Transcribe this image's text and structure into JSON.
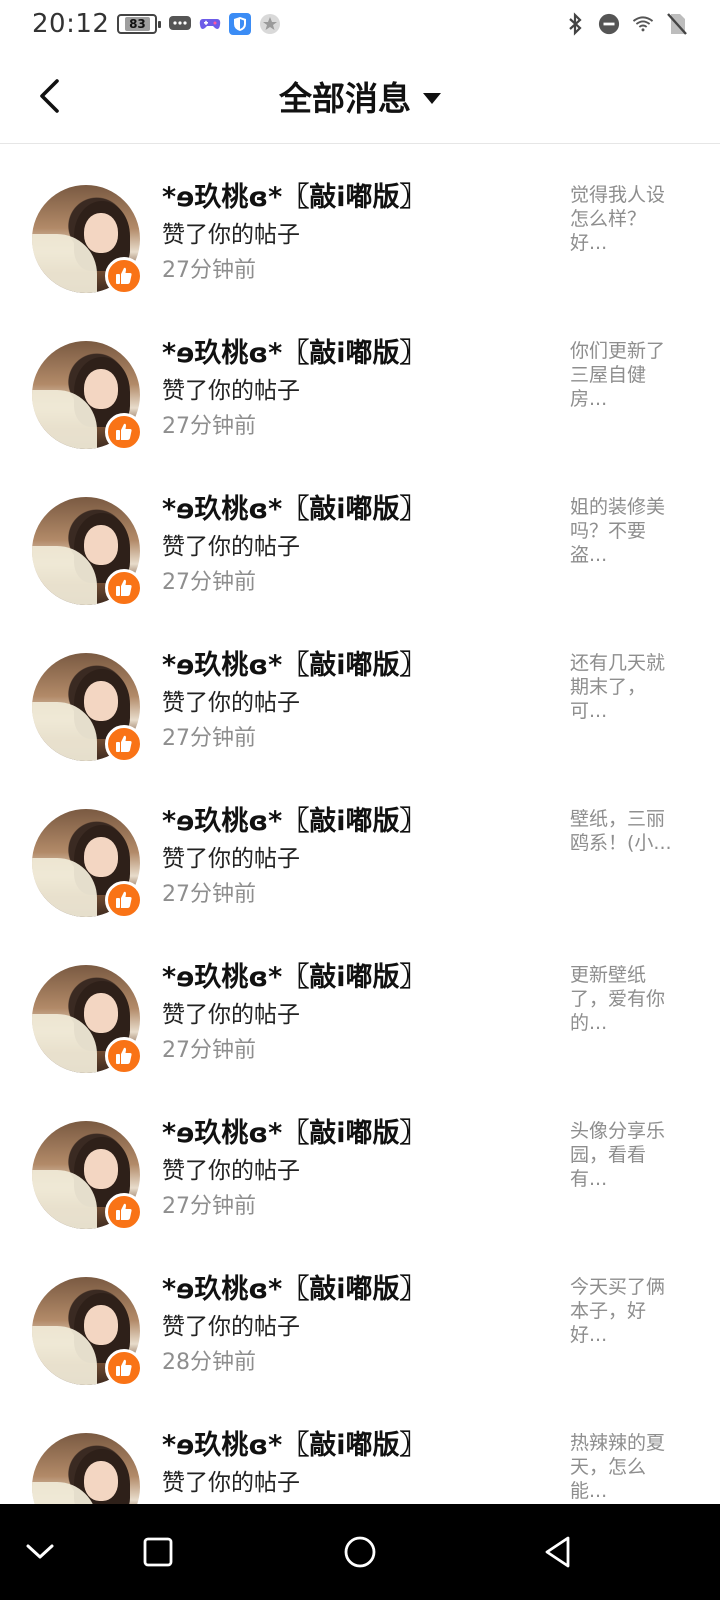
{
  "status_bar": {
    "time": "20:12",
    "battery": "83",
    "left_icons": [
      "chat-bubble-icon",
      "game-controller-icon",
      "shield-app-icon",
      "star-icon"
    ],
    "right_icons": [
      "bluetooth-icon",
      "do-not-disturb-icon",
      "wifi-icon",
      "no-sim-icon"
    ]
  },
  "header": {
    "title": "全部消息",
    "back_icon": "chevron-left-icon",
    "dropdown_icon": "caret-down-icon"
  },
  "notifications": [
    {
      "user": "*ɘ玖桃ɞ*〖敲i嘟版〗",
      "action": "赞了你的帖子",
      "time": "27分钟前",
      "preview": "觉得我人设怎么样？好..."
    },
    {
      "user": "*ɘ玖桃ɞ*〖敲i嘟版〗",
      "action": "赞了你的帖子",
      "time": "27分钟前",
      "preview": "你们更新了三屋自健房..."
    },
    {
      "user": "*ɘ玖桃ɞ*〖敲i嘟版〗",
      "action": "赞了你的帖子",
      "time": "27分钟前",
      "preview": "姐的装修美吗？不要盗..."
    },
    {
      "user": "*ɘ玖桃ɞ*〖敲i嘟版〗",
      "action": "赞了你的帖子",
      "time": "27分钟前",
      "preview": "还有几天就期末了，可..."
    },
    {
      "user": "*ɘ玖桃ɞ*〖敲i嘟版〗",
      "action": "赞了你的帖子",
      "time": "27分钟前",
      "preview": "壁纸，三丽鸥系！(小..."
    },
    {
      "user": "*ɘ玖桃ɞ*〖敲i嘟版〗",
      "action": "赞了你的帖子",
      "time": "27分钟前",
      "preview": "更新壁纸了，爱有你的..."
    },
    {
      "user": "*ɘ玖桃ɞ*〖敲i嘟版〗",
      "action": "赞了你的帖子",
      "time": "27分钟前",
      "preview": "头像分享乐园，看看有..."
    },
    {
      "user": "*ɘ玖桃ɞ*〖敲i嘟版〗",
      "action": "赞了你的帖子",
      "time": "28分钟前",
      "preview": "今天买了俩本子，好好..."
    },
    {
      "user": "*ɘ玖桃ɞ*〖敲i嘟版〗",
      "action": "赞了你的帖子",
      "time": "",
      "preview": "热辣辣的夏天，怎么能..."
    }
  ],
  "badge_icon": "thumbs-up-icon",
  "colors": {
    "accent": "#f97316",
    "muted_text": "#8e8e8e",
    "nav_background": "#000000"
  },
  "nav": {
    "icons": [
      "collapse-icon",
      "recents-icon",
      "home-icon",
      "back-icon"
    ]
  }
}
